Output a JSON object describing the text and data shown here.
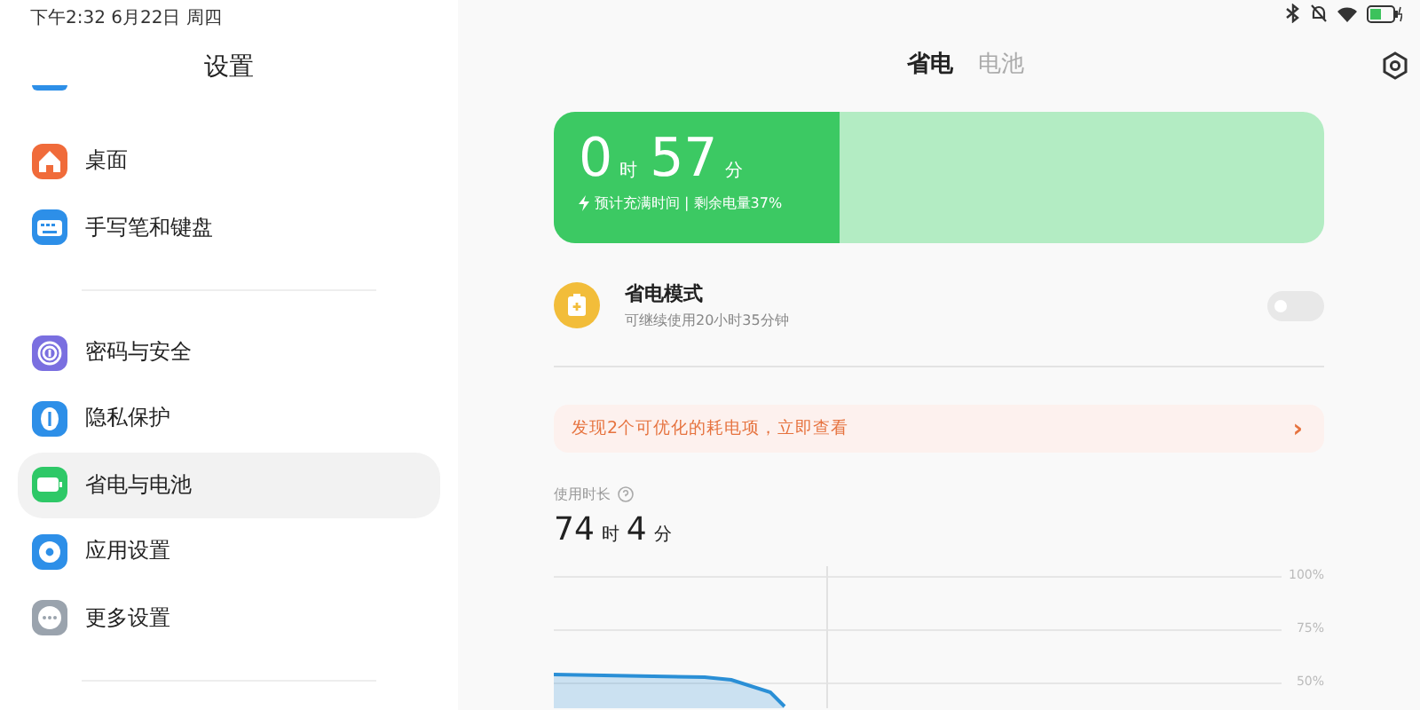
{
  "status_bar": {
    "time": "下午2:32 6月22日 周四"
  },
  "sidebar": {
    "title": "设置",
    "groups": [
      [
        {
          "label": "桌面",
          "selected": false
        },
        {
          "label": "手写笔和键盘",
          "selected": false
        }
      ],
      [
        {
          "label": "密码与安全",
          "selected": false
        },
        {
          "label": "隐私保护",
          "selected": false
        },
        {
          "label": "省电与电池",
          "selected": true
        },
        {
          "label": "应用设置",
          "selected": false
        },
        {
          "label": "更多设置",
          "selected": false
        }
      ]
    ]
  },
  "tabs": [
    {
      "label": "省电",
      "selected": true
    },
    {
      "label": "电池",
      "selected": false
    }
  ],
  "charge_card": {
    "hours": "0",
    "hours_unit": "时",
    "minutes": "57",
    "minutes_unit": "分",
    "caption": "预计充满时间 | 剩余电量37%",
    "level": 0.37
  },
  "power_saving": {
    "title": "省电模式",
    "subtitle": "可继续使用20小时35分钟",
    "on": false
  },
  "alert": {
    "text": "发现2个可优化的耗电项，立即查看",
    "chevron": "›"
  },
  "usage": {
    "label": "使用时长",
    "hours": "74",
    "hours_unit": "时",
    "minutes": "4",
    "minutes_unit": "分",
    "axis_labels": [
      "100%",
      "75%",
      "50%"
    ]
  }
}
